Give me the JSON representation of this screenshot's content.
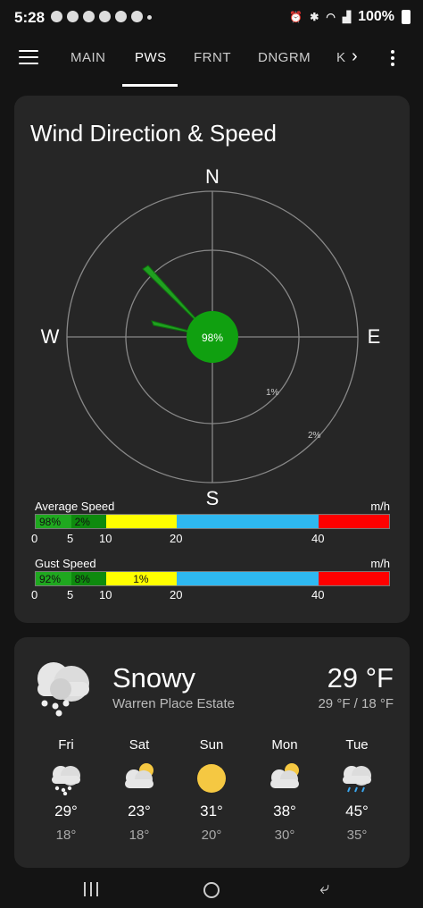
{
  "status": {
    "time": "5:28",
    "battery": "100%"
  },
  "tabs": [
    {
      "label": "MAIN"
    },
    {
      "label": "PWS"
    },
    {
      "label": "FRNT"
    },
    {
      "label": "DNGRM"
    },
    {
      "label": "K"
    }
  ],
  "wind": {
    "title": "Wind Direction & Speed",
    "directions": {
      "n": "N",
      "s": "S",
      "e": "E",
      "w": "W"
    },
    "calm_pct": "98%",
    "ring_labels": [
      "1%",
      "2%"
    ],
    "spokes": [
      {
        "direction": "NW",
        "pct": 1.5
      },
      {
        "direction": "WNW",
        "pct": 0.8
      }
    ],
    "average": {
      "label": "Average Speed",
      "unit": "m/h",
      "segments": [
        "98%",
        "2%",
        "",
        "",
        ""
      ]
    },
    "gust": {
      "label": "Gust Speed",
      "unit": "m/h",
      "segments": [
        "92%",
        "8%",
        "1%",
        "",
        ""
      ]
    },
    "ticks": [
      "0",
      "5",
      "10",
      "20",
      "40"
    ],
    "colors": [
      "#1fa81f",
      "#0e8a0e",
      "#ffff00",
      "#2eb8f0",
      "#ff0000"
    ]
  },
  "weather": {
    "condition": "Snowy",
    "location": "Warren Place Estate",
    "temp": "29 °F",
    "hilo": "29 °F / 18 °F",
    "icon": "snow-cloud-icon",
    "forecast": [
      {
        "day": "Fri",
        "hi": "29°",
        "lo": "18°",
        "icon": "snow"
      },
      {
        "day": "Sat",
        "hi": "23°",
        "lo": "18°",
        "icon": "partly-cloudy"
      },
      {
        "day": "Sun",
        "hi": "31°",
        "lo": "20°",
        "icon": "sunny"
      },
      {
        "day": "Mon",
        "hi": "38°",
        "lo": "30°",
        "icon": "partly-cloudy"
      },
      {
        "day": "Tue",
        "hi": "45°",
        "lo": "35°",
        "icon": "rain"
      }
    ]
  }
}
